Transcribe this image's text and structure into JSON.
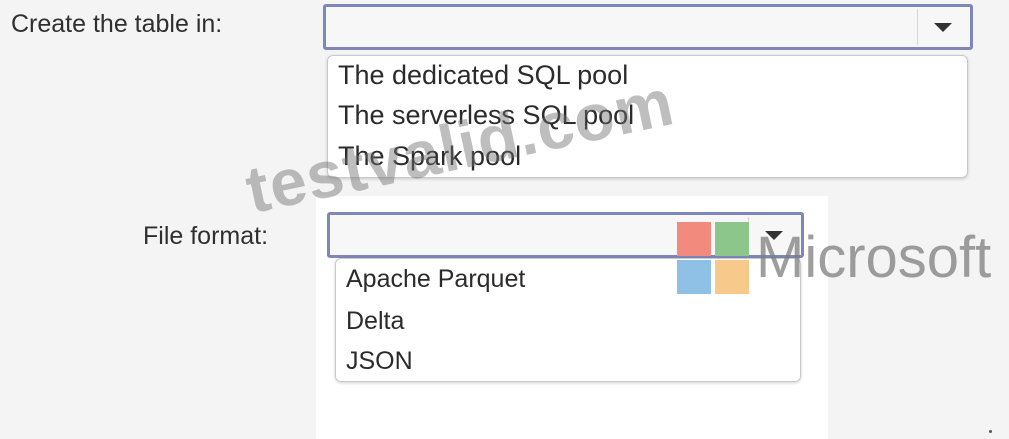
{
  "question1": {
    "label": "Create the table in:",
    "selected": "",
    "options": [
      "The dedicated SQL pool",
      "The serverless SQL pool",
      "The Spark pool"
    ]
  },
  "question2": {
    "label": "File format:",
    "selected": "",
    "options": [
      "Apache Parquet",
      "Delta",
      "JSON"
    ]
  },
  "watermark": {
    "text": "testvalid.com"
  },
  "brand": {
    "name": "Microsoft",
    "colors": {
      "red": "#f28b7e",
      "green": "#8cc68a",
      "blue": "#8fc1e6",
      "yellow": "#f7c98b"
    }
  },
  "icons": {
    "dropdown_arrow": "chevron-down-icon",
    "logo": "microsoft-logo-icon"
  }
}
